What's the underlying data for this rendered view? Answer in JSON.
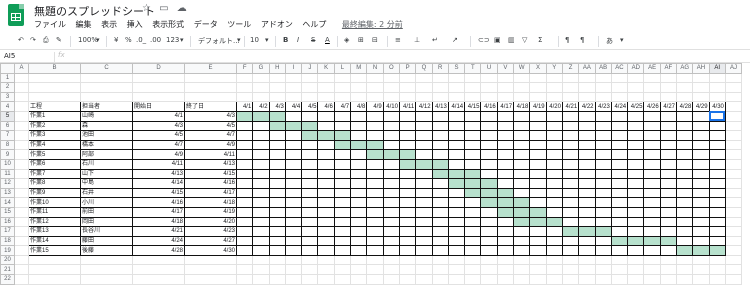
{
  "window": {
    "title": "無題のスプレッドシート",
    "icons": [
      "star-icon",
      "folder-move-icon",
      "cloud-icon"
    ]
  },
  "menu": {
    "items": [
      "ファイル",
      "編集",
      "表示",
      "挿入",
      "表示形式",
      "データ",
      "ツール",
      "アドオン",
      "ヘルプ"
    ],
    "last_edit": "最終編集: 2 分前"
  },
  "toolbar": {
    "zoom": "100%",
    "currency": "¥",
    "percent": "%",
    "decimal_decrease": ".0_",
    "decimal_increase": ".00",
    "number_format": "123",
    "font": "デフォルト...",
    "font_size": "10",
    "bold": "B",
    "italic": "I",
    "strike": "S",
    "text_color": "A",
    "more": "あ"
  },
  "formula_bar": {
    "name_box": "AI5",
    "fx": "fx",
    "value": ""
  },
  "sheet": {
    "columns": [
      "A",
      "B",
      "C",
      "D",
      "E",
      "F",
      "G",
      "H",
      "I",
      "J",
      "K",
      "L",
      "M",
      "N",
      "O",
      "P",
      "Q",
      "R",
      "S",
      "T",
      "U",
      "V",
      "W",
      "X",
      "Y",
      "Z",
      "AA",
      "AB",
      "AC",
      "AD",
      "AE",
      "AF",
      "AG",
      "AH",
      "AI",
      "AJ"
    ],
    "rows": [
      "1",
      "2",
      "3",
      "4",
      "5",
      "6",
      "7",
      "8",
      "9",
      "10",
      "11",
      "12",
      "13",
      "14",
      "15",
      "16",
      "17",
      "18",
      "19",
      "20",
      "21",
      "22"
    ],
    "selected_column": "AI",
    "selected_row": "5",
    "headers": {
      "task": "工程",
      "owner": "担当者",
      "start": "開始日",
      "end": "終了日"
    },
    "dates": [
      "4/1",
      "4/2",
      "4/3",
      "4/4",
      "4/5",
      "4/6",
      "4/7",
      "4/8",
      "4/9",
      "4/10",
      "4/11",
      "4/12",
      "4/13",
      "4/14",
      "4/15",
      "4/16",
      "4/17",
      "4/18",
      "4/19",
      "4/20",
      "4/21",
      "4/22",
      "4/23",
      "4/24",
      "4/25",
      "4/26",
      "4/27",
      "4/28",
      "4/29",
      "4/30"
    ],
    "tasks": [
      {
        "task": "作業1",
        "owner": "山崎",
        "start": "4/1",
        "end": "4/3"
      },
      {
        "task": "作業2",
        "owner": "森",
        "start": "4/3",
        "end": "4/5"
      },
      {
        "task": "作業3",
        "owner": "池田",
        "start": "4/5",
        "end": "4/7"
      },
      {
        "task": "作業4",
        "owner": "橋本",
        "start": "4/7",
        "end": "4/9"
      },
      {
        "task": "作業5",
        "owner": "阿部",
        "start": "4/9",
        "end": "4/11"
      },
      {
        "task": "作業6",
        "owner": "石川",
        "start": "4/11",
        "end": "4/13"
      },
      {
        "task": "作業7",
        "owner": "山下",
        "start": "4/13",
        "end": "4/15"
      },
      {
        "task": "作業8",
        "owner": "中島",
        "start": "4/14",
        "end": "4/16"
      },
      {
        "task": "作業9",
        "owner": "石井",
        "start": "4/15",
        "end": "4/17"
      },
      {
        "task": "作業10",
        "owner": "小川",
        "start": "4/16",
        "end": "4/18"
      },
      {
        "task": "作業11",
        "owner": "前田",
        "start": "4/17",
        "end": "4/19"
      },
      {
        "task": "作業12",
        "owner": "岡田",
        "start": "4/18",
        "end": "4/20"
      },
      {
        "task": "作業13",
        "owner": "長谷川",
        "start": "4/21",
        "end": "4/23"
      },
      {
        "task": "作業14",
        "owner": "藤田",
        "start": "4/24",
        "end": "4/27"
      },
      {
        "task": "作業15",
        "owner": "後藤",
        "start": "4/28",
        "end": "4/30"
      }
    ],
    "fill_color": "#b7e1cd",
    "selection_color": "#1a73e8"
  }
}
